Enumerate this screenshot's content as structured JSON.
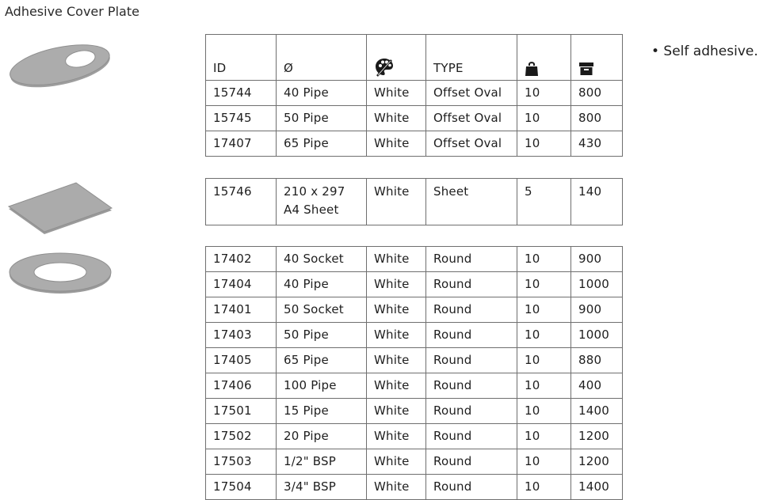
{
  "title": "Adhesive Cover Plate",
  "note": "• Self adhesive.",
  "header": {
    "id": "ID",
    "diameter": "Ø",
    "colour_icon": "palette-icon",
    "type": "TYPE",
    "pack_icon": "bag-icon",
    "box_icon": "box-icon"
  },
  "groups": [
    {
      "rows": [
        {
          "id": "15744",
          "size": "40 Pipe",
          "colour": "White",
          "type": "Offset Oval",
          "pack": "10",
          "box": "800"
        },
        {
          "id": "15745",
          "size": "50 Pipe",
          "colour": "White",
          "type": "Offset Oval",
          "pack": "10",
          "box": "800"
        },
        {
          "id": "17407",
          "size": "65 Pipe",
          "colour": "White",
          "type": "Offset Oval",
          "pack": "10",
          "box": "430"
        }
      ]
    },
    {
      "rows": [
        {
          "id": "15746",
          "size": "210 x 297",
          "size_line2": "A4 Sheet",
          "colour": "White",
          "type": "Sheet",
          "pack": "5",
          "box": "140"
        }
      ]
    },
    {
      "rows": [
        {
          "id": "17402",
          "size": "40 Socket",
          "colour": "White",
          "type": "Round",
          "pack": "10",
          "box": "900"
        },
        {
          "id": "17404",
          "size": "40 Pipe",
          "colour": "White",
          "type": "Round",
          "pack": "10",
          "box": "1000"
        },
        {
          "id": "17401",
          "size": "50 Socket",
          "colour": "White",
          "type": "Round",
          "pack": "10",
          "box": "900"
        },
        {
          "id": "17403",
          "size": "50 Pipe",
          "colour": "White",
          "type": "Round",
          "pack": "10",
          "box": "1000"
        },
        {
          "id": "17405",
          "size": "65 Pipe",
          "colour": "White",
          "type": "Round",
          "pack": "10",
          "box": "880"
        },
        {
          "id": "17406",
          "size": "100 Pipe",
          "colour": "White",
          "type": "Round",
          "pack": "10",
          "box": "400"
        },
        {
          "id": "17501",
          "size": "15 Pipe",
          "colour": "White",
          "type": "Round",
          "pack": "10",
          "box": "1400"
        },
        {
          "id": "17502",
          "size": "20 Pipe",
          "colour": "White",
          "type": "Round",
          "pack": "10",
          "box": "1200"
        },
        {
          "id": "17503",
          "size": "1/2\" BSP",
          "colour": "White",
          "type": "Round",
          "pack": "10",
          "box": "1200"
        },
        {
          "id": "17504",
          "size": "3/4\" BSP",
          "colour": "White",
          "type": "Round",
          "pack": "10",
          "box": "1400"
        }
      ]
    }
  ],
  "colors": {
    "plate_fill": "#a6a6a6",
    "plate_edge": "#888888",
    "border": "#6f6f6f"
  }
}
